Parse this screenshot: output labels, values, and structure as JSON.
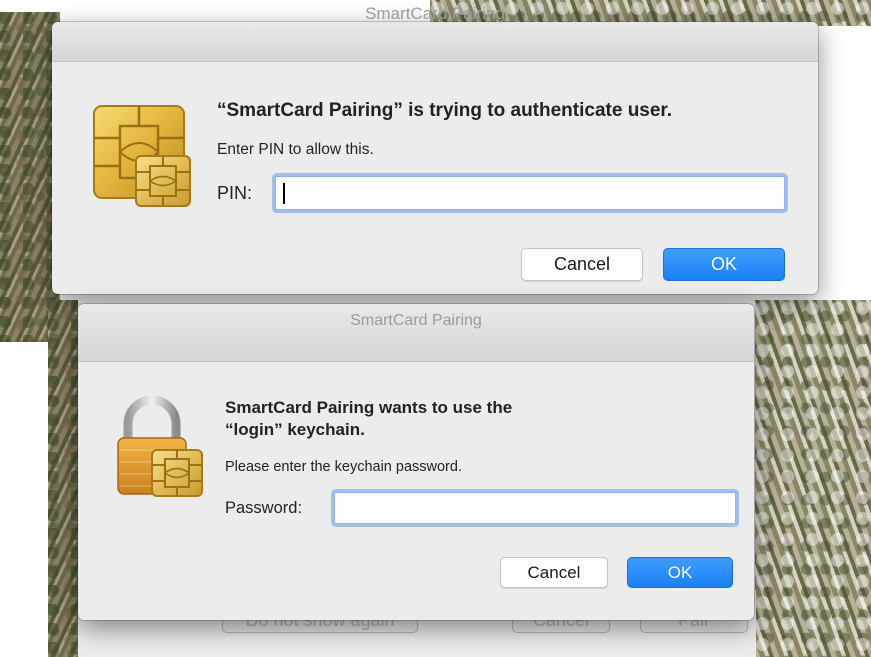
{
  "pin_dialog": {
    "window_title": "SmartCard Pairing",
    "heading": "“SmartCard Pairing” is trying to authenticate user.",
    "message": "Enter PIN to allow this.",
    "field_label": "PIN:",
    "field_value": "",
    "cancel_label": "Cancel",
    "ok_label": "OK"
  },
  "keychain_dialog": {
    "window_title": "SmartCard Pairing",
    "heading_line1": "SmartCard Pairing wants to use the",
    "heading_line2": "“login” keychain.",
    "message": "Please enter the keychain password.",
    "field_label": "Password:",
    "field_value": "",
    "cancel_label": "Cancel",
    "ok_label": "OK"
  },
  "background_dialog": {
    "buttons": [
      "Do not show again",
      "Cancel",
      "Pair"
    ]
  },
  "icons": {
    "pin_dialog_icon": "smartcard-chip-icon",
    "keychain_dialog_icon": "padlock-smartcard-icon"
  },
  "colors": {
    "accent": "#1a7ff6",
    "focus_ring": "#6799eb",
    "window_bg": "#ececec",
    "title_text": "#9b9b9b"
  }
}
